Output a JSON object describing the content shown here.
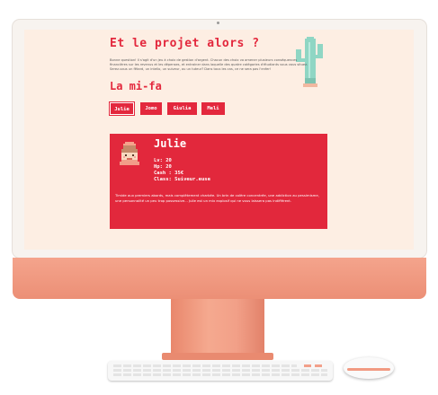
{
  "page": {
    "title": "Et le projet alors ?",
    "intro": "Bonne question! Il s'agit d'un jeu à choix de gestion d'argent. Chacun des choix va amener plusieurs conséquences financières sur les revenus et les dépenses, et entrainer dans laquelle des quatre catégories d'étudiants vous vous situez. Serez-vous un fêtard, un intello, un suiveur, ou un tuteur? Dans tous les cas, ce ne sera pas l'enfer!",
    "section_title": "La mi-fa"
  },
  "tabs": [
    {
      "label": "Julie",
      "active": true
    },
    {
      "label": "Jomo",
      "active": false
    },
    {
      "label": "Giulia",
      "active": false
    },
    {
      "label": "Meli",
      "active": false
    }
  ],
  "character": {
    "name": "Julie",
    "stats": [
      {
        "text": "Lv: 20"
      },
      {
        "text": "Hp: 20"
      },
      {
        "text": "Cash : 35€"
      },
      {
        "text": "Class: Suiveur.euse"
      }
    ],
    "description": "Timide aux premiers abords, mais complètement charbée. Un brin de colère concentrée, une addiction au pessimisme, une personnalité un peu trop possessive... Julie est un mix explosif qui ne vous laissera pas indifférent."
  },
  "colors": {
    "accent": "#e3283d",
    "screen_bg": "#fdeee3",
    "monitor": "#f19a82"
  }
}
